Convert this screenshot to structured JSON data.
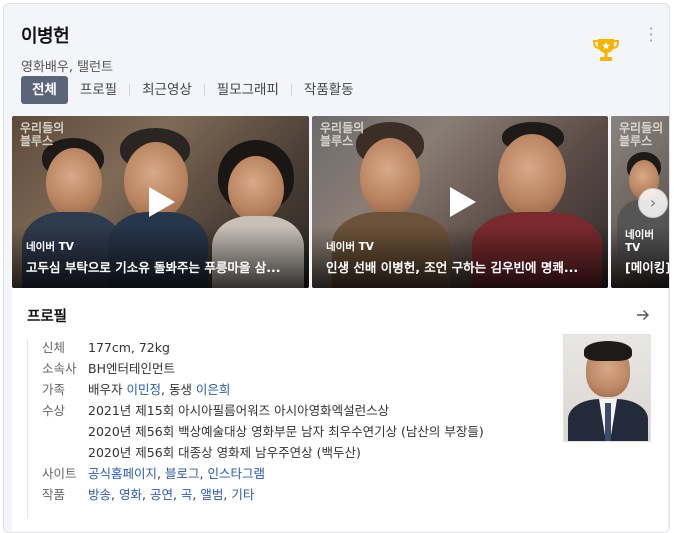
{
  "header": {
    "name": "이병헌",
    "subtitle": "영화배우, 탤런트"
  },
  "tabs": [
    {
      "label": "전체",
      "active": true
    },
    {
      "label": "프로필",
      "active": false
    },
    {
      "label": "최근영상",
      "active": false
    },
    {
      "label": "필모그래피",
      "active": false
    },
    {
      "label": "작품활동",
      "active": false
    }
  ],
  "videos": [
    {
      "series": "우리들의\n블루스",
      "source": "네이버 TV",
      "title": "고두심 부탁으로 기소유 돌봐주는 푸릉마을 삼..."
    },
    {
      "series": "우리들의\n블루스",
      "source": "네이버 TV",
      "title": "인생 선배 이병헌, 조언 구하는 김우빈에 명쾌..."
    },
    {
      "series": "우리들의\n블루스",
      "source": "네이버 TV",
      "title": "[메이킹]"
    }
  ],
  "profile": {
    "heading": "프로필",
    "rows": {
      "body": {
        "label": "신체",
        "value": "177cm, 72kg"
      },
      "agency": {
        "label": "소속사",
        "value": "BH엔터테인먼트"
      },
      "family": {
        "label": "가족",
        "prefix1": "배우자 ",
        "link1": "이민정",
        "prefix2": ", 동생 ",
        "link2": "이은희"
      },
      "awards": {
        "label": "수상",
        "items": [
          "2021년 제15회 아시아필름어워즈 아시아영화엑설런스상",
          "2020년 제56회 백상예술대상 영화부문 남자 최우수연기상 (남산의 부장들)",
          "2020년 제56회 대종상 영화제 남우주연상 (백두산)"
        ]
      },
      "site": {
        "label": "사이트",
        "links": [
          "공식홈페이지",
          "블로그",
          "인스타그램"
        ]
      },
      "works": {
        "label": "작품",
        "links": [
          "방송",
          "영화",
          "공연",
          "곡",
          "앨범",
          "기타"
        ]
      }
    }
  },
  "colors": {
    "active_tab": "#5c6479",
    "link": "#2c5aa7",
    "trophy": "#f4b400"
  },
  "icons": {
    "trophy": "trophy-icon",
    "more": "more-vertical-icon",
    "play": "play-icon",
    "next": "chevron-right-icon",
    "arrow": "arrow-right-icon"
  }
}
